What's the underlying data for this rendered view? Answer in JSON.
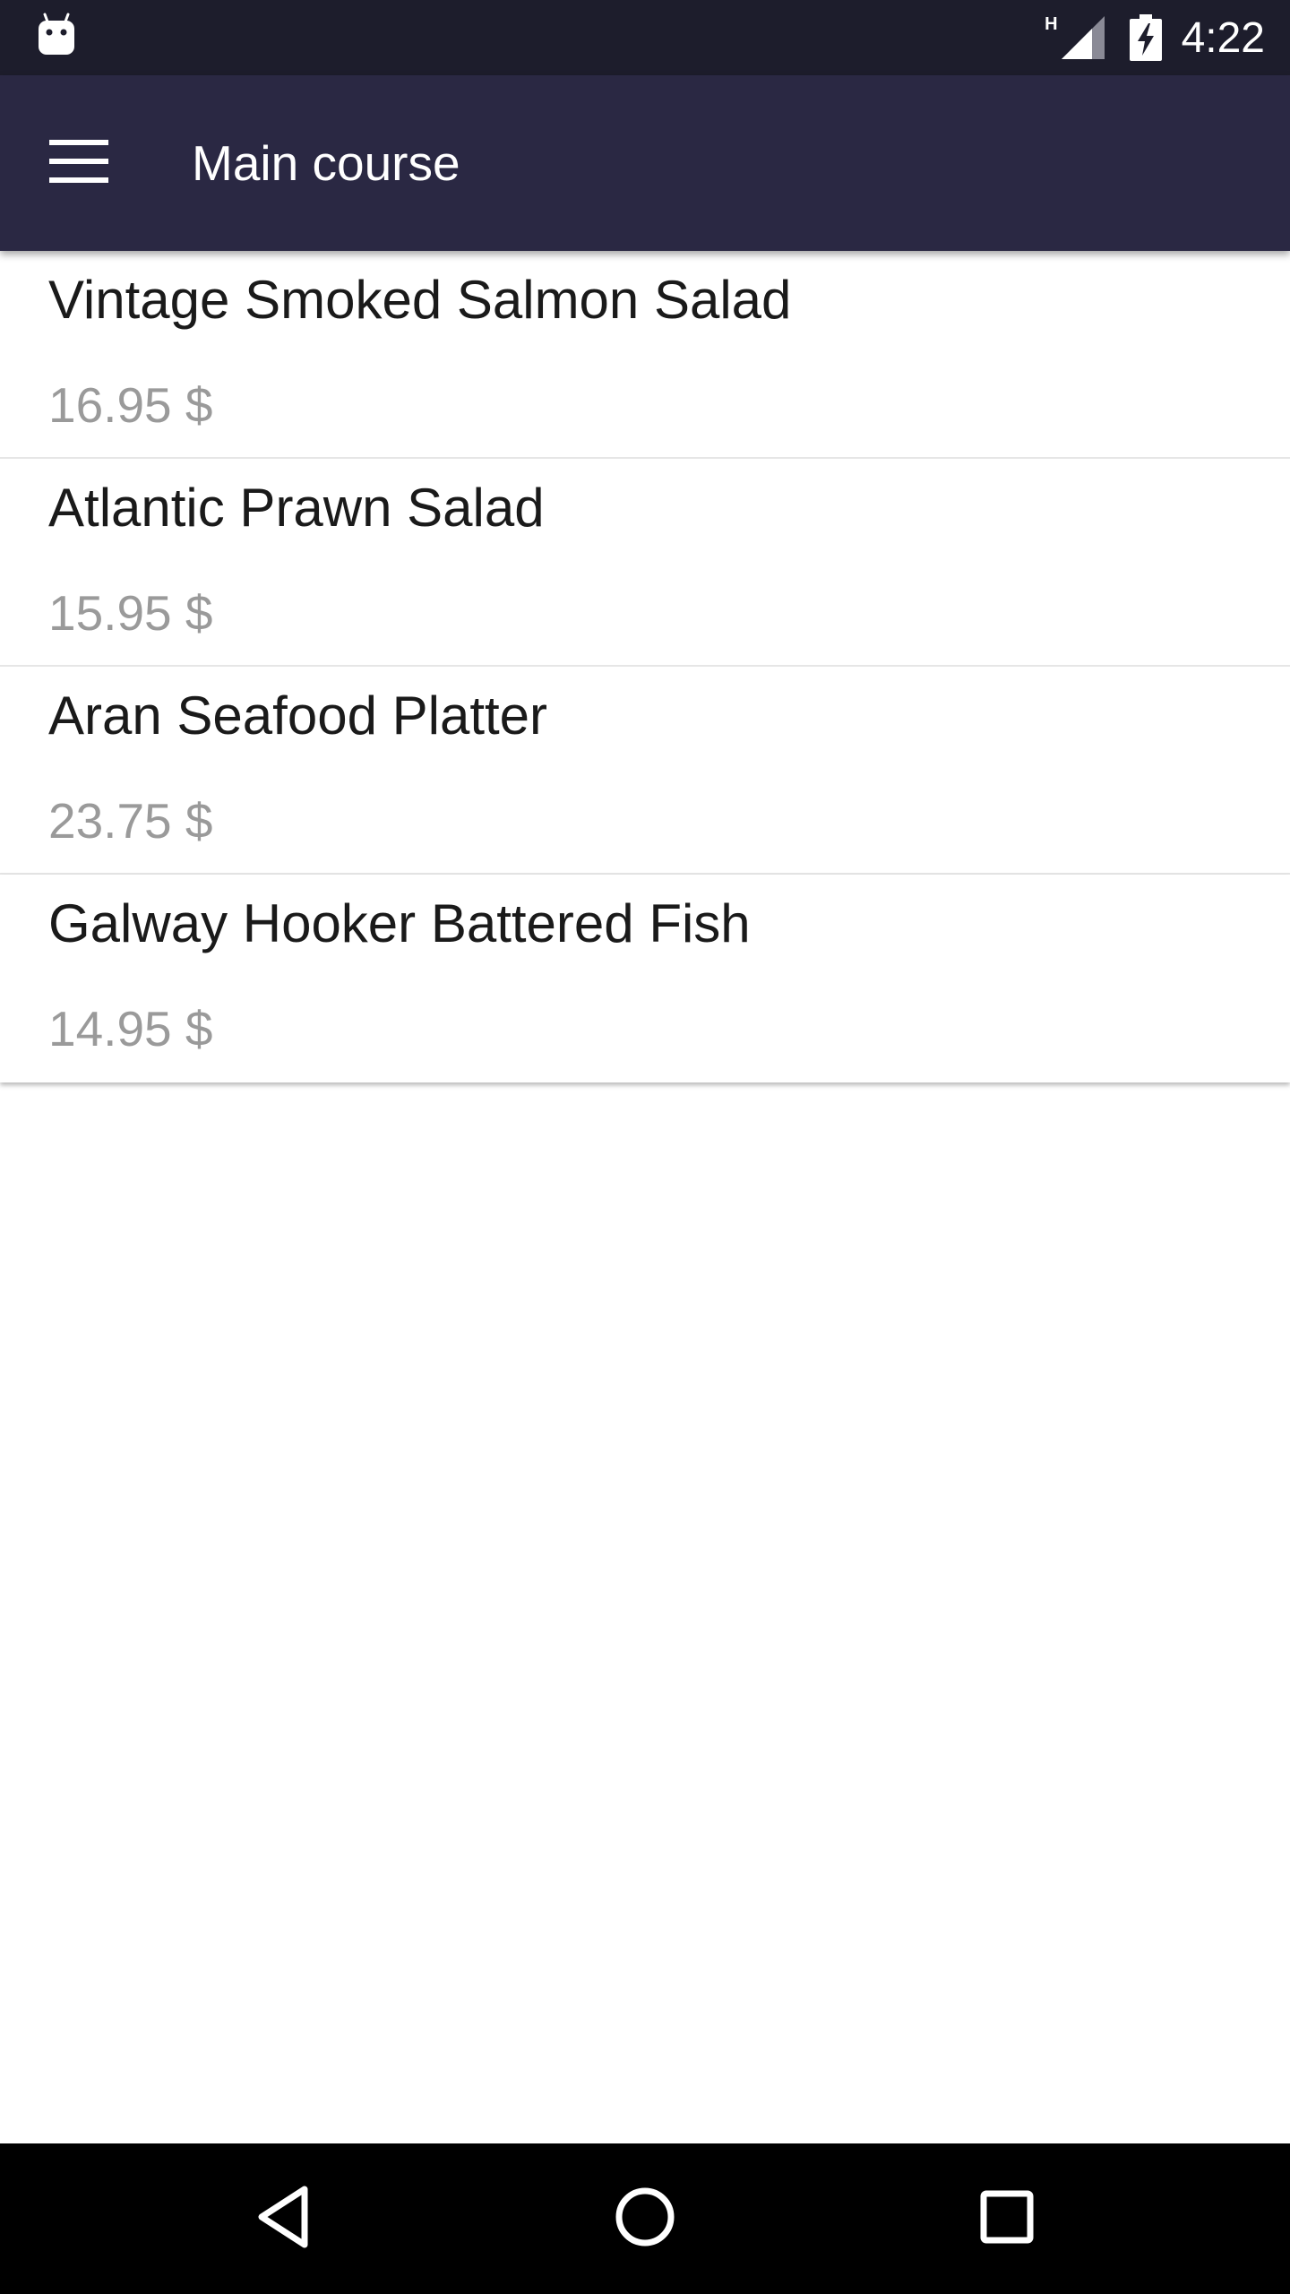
{
  "status_bar": {
    "network_type": "H",
    "time": "4:22",
    "icons": {
      "left": "android-robot-icon",
      "signal": "signal-icon",
      "battery": "battery-charging-icon"
    }
  },
  "app_bar": {
    "title": "Main course",
    "menu_icon": "hamburger-menu-icon",
    "background": "#2a2843"
  },
  "items": [
    {
      "name": "Vintage Smoked Salmon Salad",
      "price": "16.95 $"
    },
    {
      "name": "Atlantic Prawn Salad",
      "price": "15.95 $"
    },
    {
      "name": "Aran Seafood Platter",
      "price": "23.75 $"
    },
    {
      "name": "Galway Hooker Battered Fish",
      "price": "14.95 $"
    }
  ],
  "nav_bar": {
    "back_icon": "back-triangle-icon",
    "home_icon": "home-circle-icon",
    "recents_icon": "recents-square-icon"
  },
  "colors": {
    "status_bar": "#1d1d2c",
    "app_bar": "#2a2843",
    "item_name": "#1a1a1a",
    "item_price": "#9a9a9a",
    "nav_bar": "#000000"
  }
}
